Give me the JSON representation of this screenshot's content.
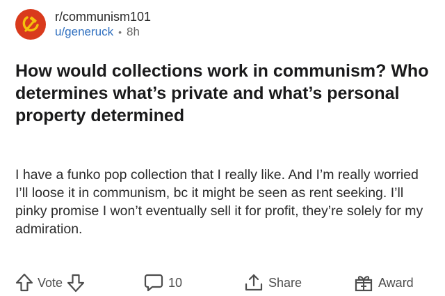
{
  "post": {
    "subreddit": "r/communism101",
    "author": "u/generuck",
    "separator": "•",
    "age": "8h",
    "title": "How would collections work in communism? Who determines what’s private and what’s personal property determined",
    "body": "I have a funko pop collection that I really like. And I’m really worried I’ll loose it in communism, bc it might be seen as rent seeking. I’ll pinky promise I won’t eventually sell it for profit, they’re solely for my admiration."
  },
  "actions": {
    "vote_label": "Vote",
    "comments_count": "10",
    "share_label": "Share",
    "award_label": "Award"
  },
  "icons": {
    "subreddit_avatar": "hammer-and-sickle-icon",
    "upvote": "arrow-up-icon",
    "downvote": "arrow-down-icon",
    "comments": "speech-bubble-icon",
    "share": "share-icon",
    "award": "gift-icon"
  },
  "colors": {
    "avatar_bg": "#d93a1c",
    "author_link": "#2f6fbf",
    "text": "#1a1a1b"
  }
}
